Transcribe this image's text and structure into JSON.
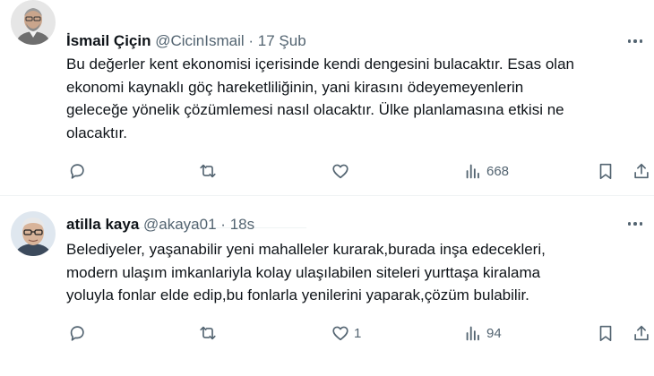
{
  "posts": [
    {
      "author": "İsmail Çiçin",
      "handle": "@CicinIsmail",
      "separator": "·",
      "time": "17 Şub",
      "lines": [
        "Bu değerler kent ekonomisi içerisinde kendi dengesini bulacaktır. Esas olan",
        "ekonomi kaynaklı  göç hareketliliğinin, yani kirasını ödeyemeyenlerin",
        "geleceğe yönelik çözümlemesi nasıl olacaktır. Ülke planlamasına etkisi ne",
        "olacaktır."
      ],
      "likes": "",
      "views": "668"
    },
    {
      "author": "atilla kaya",
      "handle": "@akaya01",
      "separator": "·",
      "time": "18s",
      "lines": [
        "Belediyeler, yaşanabilir yeni mahalleler kurarak,burada inşa edecekleri,",
        "modern ulaşım imkanlariyla kolay ulaşılabilen siteleri yurttaşa kiralama",
        "yoluyla fonlar elde edip,bu fonlarla yenilerini yaparak,çözüm bulabilir."
      ],
      "likes": "1",
      "views": "94"
    }
  ],
  "icons": {
    "reply": "reply-icon",
    "repost": "repost-icon",
    "like": "heart-icon",
    "views": "views-icon",
    "bookmark": "bookmark-icon",
    "share": "share-icon",
    "more": "more-icon"
  },
  "colors": {
    "text": "#0f1419",
    "muted": "#536471",
    "divider": "#eff3f4"
  }
}
